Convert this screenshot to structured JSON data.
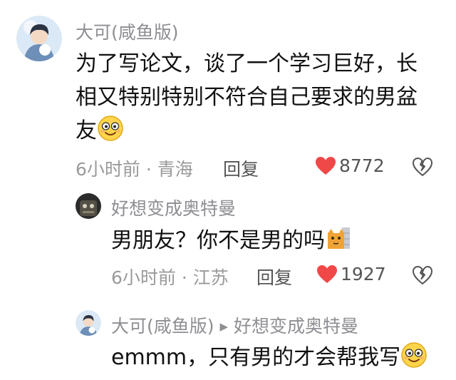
{
  "comment": {
    "author": "大可(咸鱼版)",
    "text_line1": "为了写论文，谈了一个学习巨好，长",
    "text_line2": "相又特别特别不符合自己要求的男盆",
    "text_line3": "友",
    "emoji": "smiling-face-emoji",
    "time": "6小时前",
    "location": "青海",
    "reply_label": "回复",
    "likes": "8772",
    "colors": {
      "like": "#f04848",
      "name": "#8e8e93"
    }
  },
  "reply1": {
    "author": "好想变成奥特曼",
    "text": "男朋友？你不是男的吗",
    "emoji": "cat-face-sticker",
    "time": "6小时前",
    "location": "江苏",
    "reply_label": "回复",
    "likes": "1927"
  },
  "reply2": {
    "author": "大可(咸鱼版)",
    "arrow": "▶",
    "reply_to": "好想变成奥特曼",
    "text": "emmm，只有男的才会帮我写",
    "emoji": "smiling-face-emoji"
  }
}
